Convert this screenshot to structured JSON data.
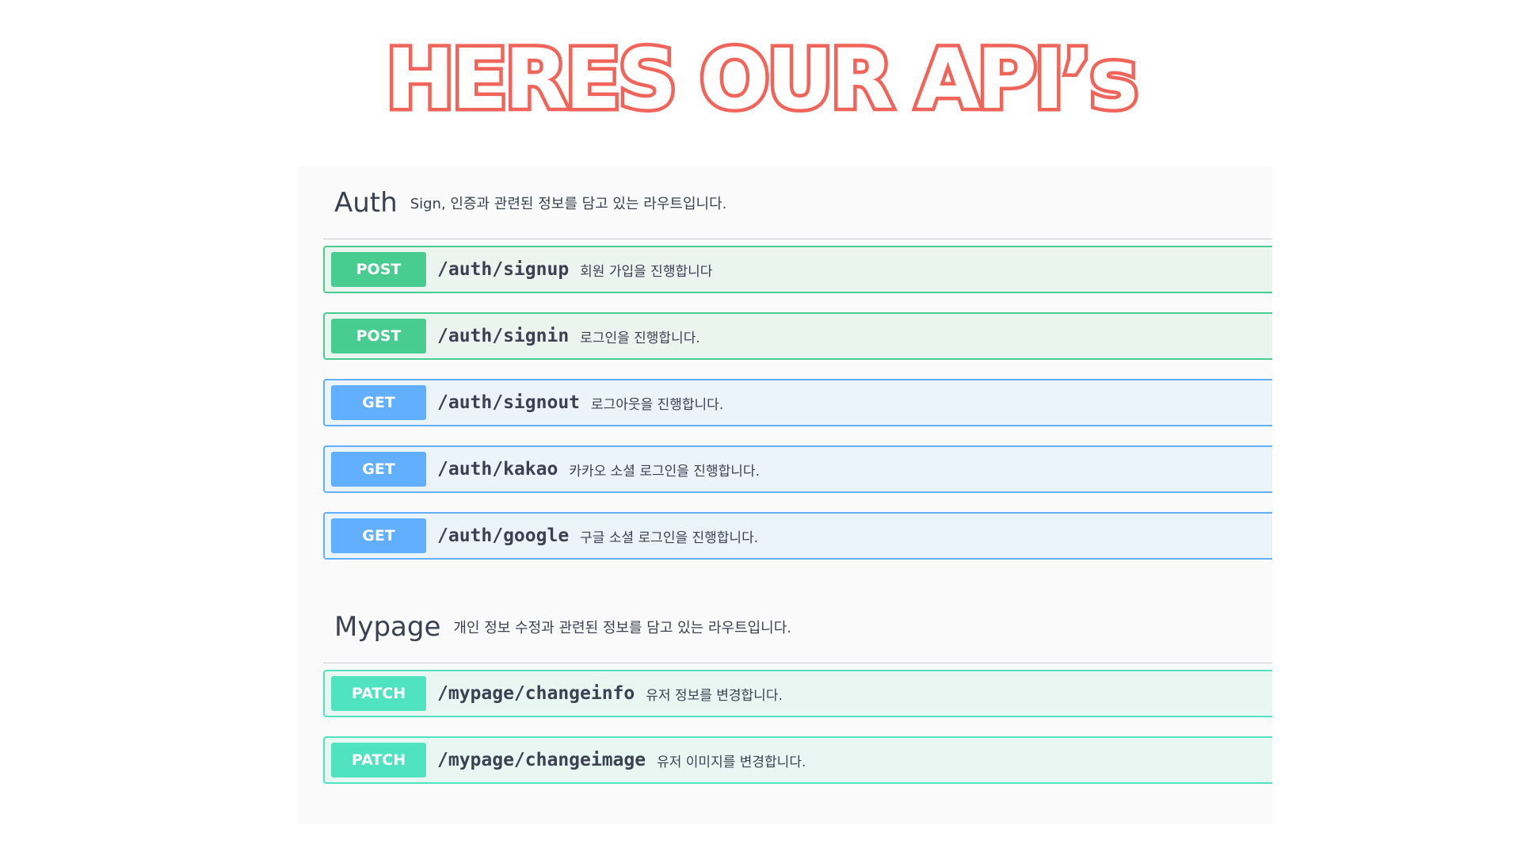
{
  "headline": "HERES OUR API’s",
  "colors": {
    "headline_stroke": "#f0645a",
    "post": "#49cc90",
    "get": "#61affe",
    "patch": "#50e3c2",
    "text": "#3b4151"
  },
  "sections": [
    {
      "name": "Auth",
      "description": "Sign, 인증과 관련된 정보를 담고 있는 라우트입니다.",
      "operations": [
        {
          "method": "POST",
          "path": "/auth/signup",
          "summary": "회원 가입을 진행합니다"
        },
        {
          "method": "POST",
          "path": "/auth/signin",
          "summary": "로그인을 진행합니다."
        },
        {
          "method": "GET",
          "path": "/auth/signout",
          "summary": "로그아웃을 진행합니다."
        },
        {
          "method": "GET",
          "path": "/auth/kakao",
          "summary": "카카오 소셜 로그인을 진행합니다."
        },
        {
          "method": "GET",
          "path": "/auth/google",
          "summary": "구글 소셜 로그인을 진행합니다."
        }
      ]
    },
    {
      "name": "Mypage",
      "description": "개인 정보 수정과 관련된 정보를 담고 있는 라우트입니다.",
      "operations": [
        {
          "method": "PATCH",
          "path": "/mypage/changeinfo",
          "summary": "유저 정보를 변경합니다."
        },
        {
          "method": "PATCH",
          "path": "/mypage/changeimage",
          "summary": "유저 이미지를 변경합니다."
        }
      ]
    }
  ]
}
